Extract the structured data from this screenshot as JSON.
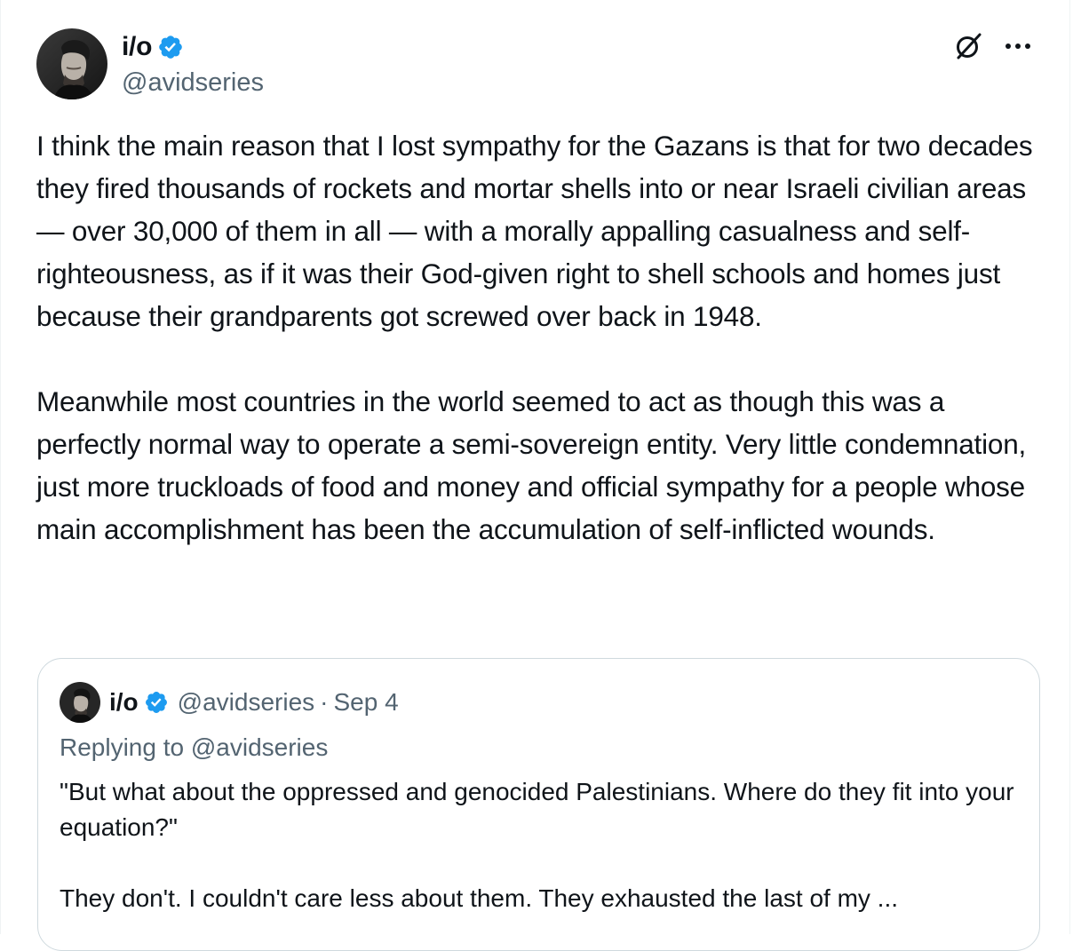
{
  "tweet": {
    "author": {
      "display_name": "i/o",
      "handle": "@avidseries",
      "verified": true,
      "avatar_icon": "person-avatar"
    },
    "actions": {
      "grok_icon": "grok-icon",
      "more_icon": "more-horizontal-icon"
    },
    "text": "I think the main reason that I lost sympathy for the Gazans is that for two decades they fired thousands of rockets and mortar shells into or near Israeli civilian areas — over 30,000 of them in all — with a morally appalling casualness and self-righteousness, as if it was their God-given right to shell schools and homes just because their grandparents got screwed over back in 1948.\n\nMeanwhile most countries in the world seemed to act as though this was a perfectly normal way to operate a semi-sovereign entity. Very little condemnation, just more truckloads of food and money and official sympathy for a people whose main accomplishment has been the accumulation of self-inflicted wounds."
  },
  "quote": {
    "author": {
      "display_name": "i/o",
      "handle": "@avidseries",
      "verified": true
    },
    "separator": "·",
    "date": "Sep 4",
    "replying_to": "Replying to @avidseries",
    "text": "\"But what about the oppressed and genocided Palestinians. Where do they fit into your equation?\"\n\nThey don't. I couldn't care less about them. They exhausted the last of my ..."
  },
  "colors": {
    "verified": "#1d9bf0",
    "secondary_text": "#536471",
    "border": "#cfd9de"
  }
}
